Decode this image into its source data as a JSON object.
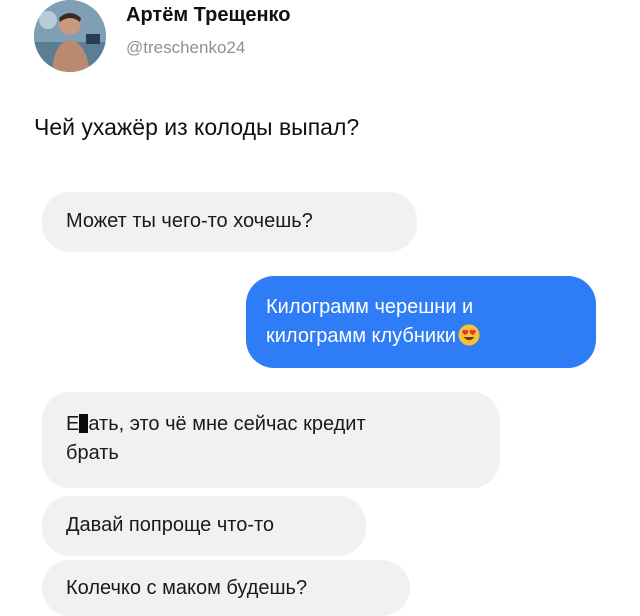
{
  "header": {
    "name": "Артём Трещенко",
    "handle": "@treschenko24"
  },
  "tweet": {
    "text": "Чей ухажёр из колоды выпал?"
  },
  "messages": [
    {
      "side": "incoming",
      "text": "Может ты чего-то хочешь?"
    },
    {
      "side": "outgoing",
      "line1": "Килограмм черешни и",
      "line2": "килограмм клубники",
      "emoji": "heart-eyes-emoji"
    },
    {
      "side": "incoming",
      "prefix": "Е",
      "line1_rest": "ать, это чё мне сейчас кредит",
      "line2": "брать",
      "redaction": "censor-bar"
    },
    {
      "side": "incoming",
      "text": "Давай попроще что-то"
    },
    {
      "side": "incoming",
      "text": "Колечко с маком будешь?"
    }
  ],
  "colors": {
    "incoming_bubble": "#f0f1f3",
    "outgoing_bubble": "#2f7df6",
    "handle_text": "#8a9199"
  }
}
